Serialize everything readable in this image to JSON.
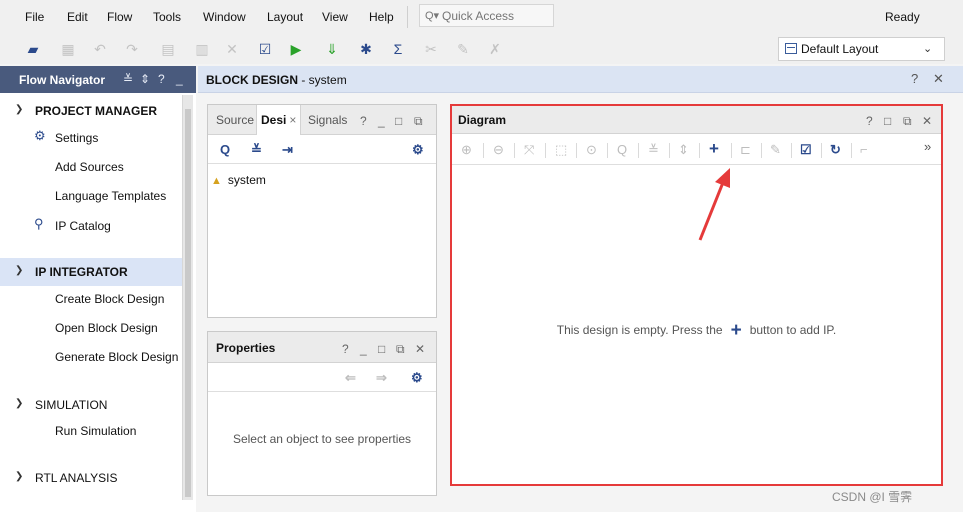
{
  "menu": {
    "items": [
      {
        "label": "File"
      },
      {
        "label": "Edit"
      },
      {
        "label": "Flow"
      },
      {
        "label": "Tools"
      },
      {
        "label": "Window"
      },
      {
        "label": "Layout"
      },
      {
        "label": "View"
      },
      {
        "label": "Help"
      }
    ],
    "quick_access_placeholder": "Quick Access",
    "status": "Ready"
  },
  "toolbar": {
    "icons": [
      "open-project-icon",
      "save-icon",
      "undo-icon",
      "redo-icon",
      "copy-icon",
      "paste-icon",
      "delete-icon",
      "validate-icon",
      "run-icon",
      "run-synthesis-icon",
      "settings-icon",
      "sigma-icon",
      "cut-icon",
      "edit-icon",
      "disconnect-icon"
    ],
    "layout_selected": "Default Layout"
  },
  "flow_navigator": {
    "title": "Flow Navigator",
    "sections": {
      "project_manager": {
        "label": "PROJECT MANAGER",
        "items": {
          "settings": "Settings",
          "add_sources": "Add Sources",
          "language_templates": "Language Templates",
          "ip_catalog": "IP Catalog"
        }
      },
      "ip_integrator": {
        "label": "IP INTEGRATOR",
        "items": {
          "create_block_design": "Create Block Design",
          "open_block_design": "Open Block Design",
          "generate_block_design": "Generate Block Design"
        }
      },
      "simulation": {
        "label": "SIMULATION",
        "items": {
          "run_simulation": "Run Simulation"
        }
      },
      "rtl_analysis": {
        "label": "RTL ANALYSIS"
      }
    }
  },
  "main": {
    "header_bold": "BLOCK DESIGN",
    "header_rest": " - system",
    "sources_panel": {
      "tabs": {
        "source": "Source",
        "design": "Desi",
        "signals": "Signals"
      },
      "tree_item": "system"
    },
    "properties_panel": {
      "title": "Properties",
      "empty_text": "Select an object to see properties"
    },
    "diagram_panel": {
      "title": "Diagram",
      "empty_text_before": "This design is empty. Press the",
      "empty_text_after": "button to add IP."
    }
  },
  "watermark": "CSDN @I 雪霁",
  "colors": {
    "nav_header": "#495a7d",
    "active_section": "#dae4f6",
    "highlight_border": "#e53a3a",
    "icon_blue": "#2b4a8c"
  }
}
